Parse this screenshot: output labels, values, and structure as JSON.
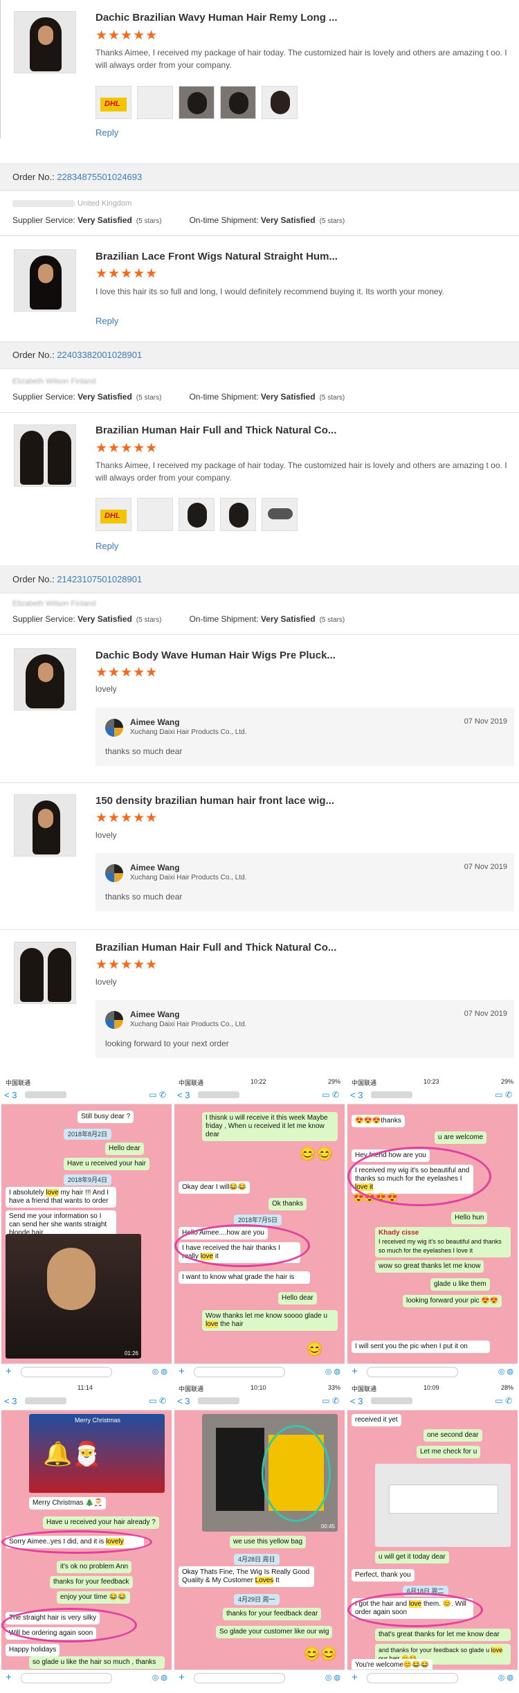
{
  "reviews": [
    {
      "product": "Dachic Brazilian Wavy Human Hair Remy Long ...",
      "stars": "★★★★★",
      "text": "Thanks Aimee, I received my package of hair today. The customized hair is lovely and others are amazing t oo. I will always order from your company.",
      "photo_labels": [
        "DHL",
        "",
        "",
        "",
        ""
      ],
      "reply": "Reply"
    },
    {
      "order_label": "Order No.:",
      "order_no": "22834875501024693",
      "buyer_country": "United Kingdom",
      "supplier_label": "Supplier Service:",
      "supplier_value": "Very Satisfied",
      "supplier_stars": "(5 stars)",
      "shipment_label": "On-time Shipment:",
      "shipment_value": "Very Satisfied",
      "shipment_stars": "(5 stars)",
      "product": "Brazilian Lace Front Wigs Natural Straight Hum...",
      "stars": "★★★★★",
      "text": "I love this hair its so full and long, I would definitely recommend buying it. Its worth your money.",
      "reply": "Reply"
    },
    {
      "order_label": "Order No.:",
      "order_no": "22403382001028901",
      "buyer_name": "Elizabeth Wilson Finland",
      "supplier_label": "Supplier Service:",
      "supplier_value": "Very Satisfied",
      "supplier_stars": "(5 stars)",
      "shipment_label": "On-time Shipment:",
      "shipment_value": "Very Satisfied",
      "shipment_stars": "(5 stars)",
      "product": "Brazilian Human Hair Full and Thick Natural Co...",
      "stars": "★★★★★",
      "text": "Thanks Aimee, I received my package of hair today. The customized hair is lovely and others are amazing t oo. I will always order from your company.",
      "photo_labels": [
        "DHL",
        "",
        "",
        "",
        ""
      ],
      "reply": "Reply"
    },
    {
      "order_label": "Order No.:",
      "order_no": "21423107501028901",
      "buyer_name": "Elizabeth Wilson Finland",
      "supplier_label": "Supplier Service:",
      "supplier_value": "Very Satisfied",
      "supplier_stars": "(5 stars)",
      "shipment_label": "On-time Shipment:",
      "shipment_value": "Very Satisfied",
      "shipment_stars": "(5 stars)",
      "product": "Dachic Body Wave Human Hair Wigs Pre Pluck...",
      "stars": "★★★★★",
      "text": "lovely",
      "seller": "Aimee Wang",
      "company": "Xuchang Daixi Hair Products Co., Ltd.",
      "date": "07 Nov 2019",
      "seller_reply": "thanks so much dear"
    },
    {
      "product": "150 density brazilian human hair front lace wig...",
      "stars": "★★★★★",
      "text": "lovely",
      "seller": "Aimee Wang",
      "company": "Xuchang Daixi Hair Products Co., Ltd.",
      "date": "07 Nov 2019",
      "seller_reply": "thanks so much dear"
    },
    {
      "product": "Brazilian Human Hair Full and Thick Natural Co...",
      "stars": "★★★★★",
      "text": "lovely",
      "seller": "Aimee Wang",
      "company": "Xuchang Daixi Hair Products Co., Ltd.",
      "date": "07 Nov 2019",
      "seller_reply": "looking forward to your next order"
    }
  ],
  "chats": {
    "status": {
      "carrier": "中国联通",
      "times": [
        "",
        "10:22",
        "10:23",
        "11:14",
        "10:10",
        "10:09"
      ],
      "battery": [
        "",
        "29%",
        "29%",
        "",
        "33%",
        "28%"
      ]
    },
    "back": "< 3",
    "p1": {
      "m1": "Still busy dear ?",
      "d1": "2018年8月2日",
      "m2": "Hello dear",
      "m3": "Have u received your hair",
      "d2": "2018年9月4日",
      "m4a": "I absolutely ",
      "m4b": "love",
      "m4c": " my hair !!! And I have a friend that wants to order",
      "m5": "Send me your information so I can send her she wants straight blonde hair",
      "dur": "01:26"
    },
    "p2": {
      "m1": "I thisnk u will receive it this week Maybe friday , When u received it let me know dear",
      "m2": "Okay dear I will😂😂",
      "m3": "Ok thanks",
      "d1": "2018年7月5日",
      "m4": "Hello Aimee....how are you",
      "m5a": "I have received the hair thanks I really ",
      "m5b": "love",
      "m5c": " it",
      "m6": "I want to know what grade the hair is",
      "m7": "Hello dear",
      "m8a": "Wow thanks let me know soooo glade u ",
      "m8b": "love",
      "m8c": " the hair"
    },
    "p3": {
      "m1": "😍😍😍thanks",
      "m2": "u are welcome",
      "m3": "Hey friend  how are you",
      "m4a": "I received  my wig  it's so beautiful  and thanks  so much  for the eyelashes  I ",
      "m4b": "love it",
      "m5": "Hello hun",
      "m6n": "Khady cisse",
      "m6": "I received  my wig  it's so beautiful  and  thanks  so much  for the eyelashes  I love it",
      "m7": "wow so great thanks let me know",
      "m8": "glade u like them",
      "m9": "looking forward your pic 😍😍",
      "m10": "I will  sent you the pic when I put  it  on"
    },
    "p4": {
      "m1": "Merry Christmas 🎄🎅",
      "m2": "Have u received your hair already ?",
      "m3a": "Sorry Aimee..yes I did, and it is ",
      "m3b": "lovely",
      "m4": "it's ok no problem Ann",
      "m5": "thanks for your feedback",
      "m6": "enjoy your time 😂😂",
      "m7": "The straight hair is very silky",
      "m8": "Will be ordering again soon",
      "m9": "Happy holidays",
      "m10": "so glade u like the hair so much , thanks",
      "card": "Merry Christmas"
    },
    "p5": {
      "m1": "we use this yellow bag",
      "d1": "4月28日 周日",
      "m2a": "Okay Thats Fine, The Wig Is Really Good Quality & My Customer ",
      "m2b": "Loves",
      "m2c": " It",
      "d2": "4月29日 周一",
      "m3": "thanks for your feedback dear",
      "m4": "So glade your customer like our wig",
      "dur": "00:45"
    },
    "p6": {
      "m1": "received it yet",
      "m2": "one second dear",
      "m3": "Let me check for u",
      "m4": "u will get it today dear",
      "m5": "Perfect, thank you",
      "d1": "6月18日 周二",
      "m6a": "I got the hair and ",
      "m6b": "love",
      "m6c": " them. 😊. Will order again soon",
      "m7": "that's great thanks for let me know dear",
      "m8a": "and thanks for your feedback so glade u ",
      "m8b": "love",
      "m8c": " our hair 😊😂",
      "m9": "You're welcome😊😂😂"
    }
  }
}
